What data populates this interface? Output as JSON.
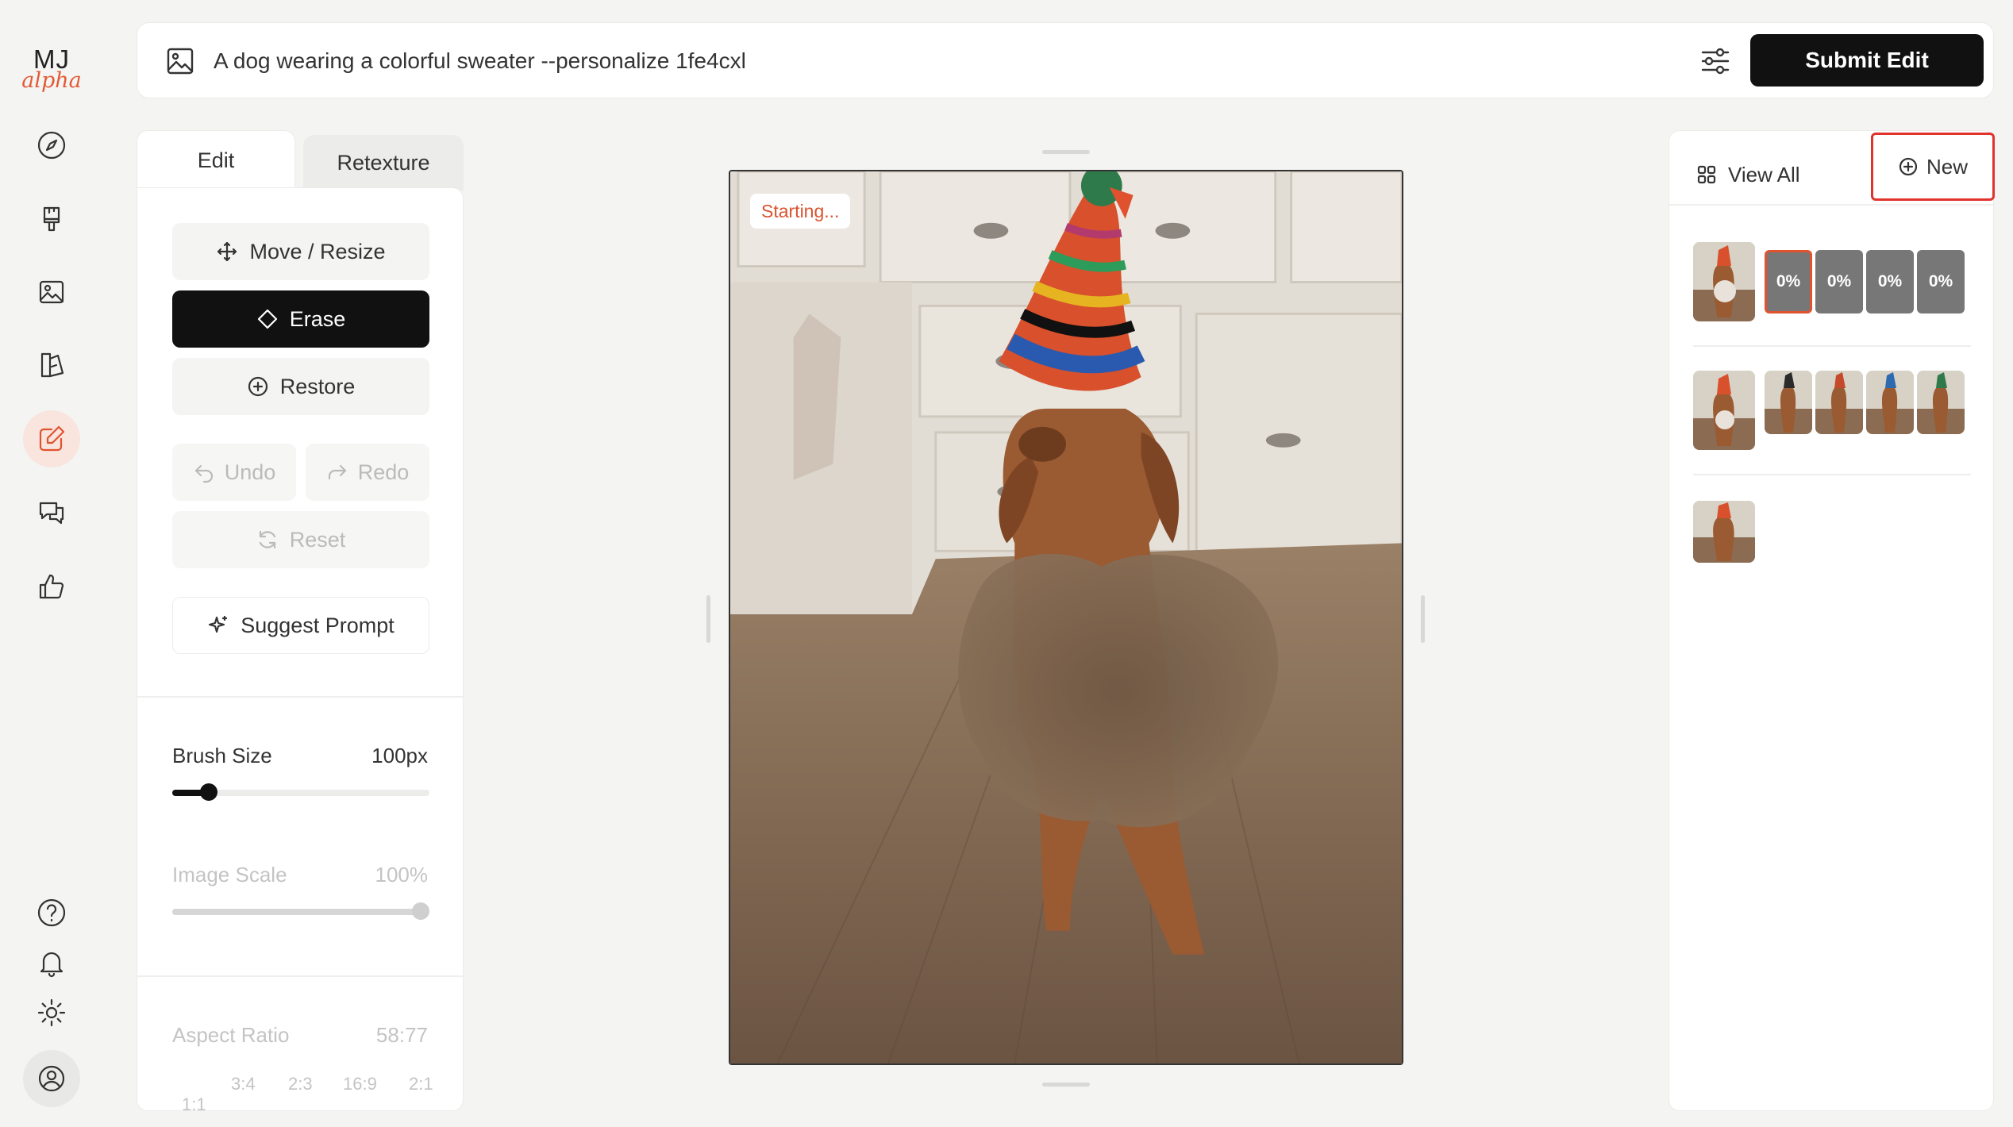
{
  "logo": {
    "primary": "MJ",
    "secondary": "alpha"
  },
  "sidebar": {
    "items": [
      {
        "name": "explore",
        "icon": "compass-icon"
      },
      {
        "name": "create",
        "icon": "paintbrush-icon"
      },
      {
        "name": "organize",
        "icon": "image-icon"
      },
      {
        "name": "personalize",
        "icon": "moodboard-icon"
      },
      {
        "name": "edit",
        "icon": "edit-icon",
        "active": true
      },
      {
        "name": "chat",
        "icon": "chat-icon"
      },
      {
        "name": "rate",
        "icon": "thumbs-up-icon"
      }
    ],
    "bottom": [
      "help-icon",
      "bell-icon",
      "sun-icon",
      "user-avatar-icon"
    ]
  },
  "topbar": {
    "prompt": "A dog wearing a colorful sweater --personalize 1fe4cxl",
    "submit_label": "Submit Edit"
  },
  "tabs": {
    "edit": "Edit",
    "retexture": "Retexture"
  },
  "tools": {
    "move_resize": "Move / Resize",
    "erase": "Erase",
    "restore": "Restore",
    "undo": "Undo",
    "redo": "Redo",
    "reset": "Reset",
    "suggest_prompt": "Suggest Prompt"
  },
  "brush": {
    "label": "Brush Size",
    "value": "100px",
    "fraction": 0.1
  },
  "image_scale": {
    "label": "Image Scale",
    "value": "100%",
    "fraction": 1.0
  },
  "aspect": {
    "label": "Aspect Ratio",
    "value": "58:77",
    "options": [
      "1:1",
      "3:4",
      "2:3",
      "16:9",
      "2:1"
    ]
  },
  "canvas": {
    "status": "Starting..."
  },
  "right_panel": {
    "view_all": "View All",
    "new_label": "New",
    "progress_tiles": [
      "0%",
      "0%",
      "0%",
      "0%"
    ]
  },
  "colors": {
    "accent": "#e0532f",
    "highlight": "#e0332c",
    "dark": "#111111"
  }
}
